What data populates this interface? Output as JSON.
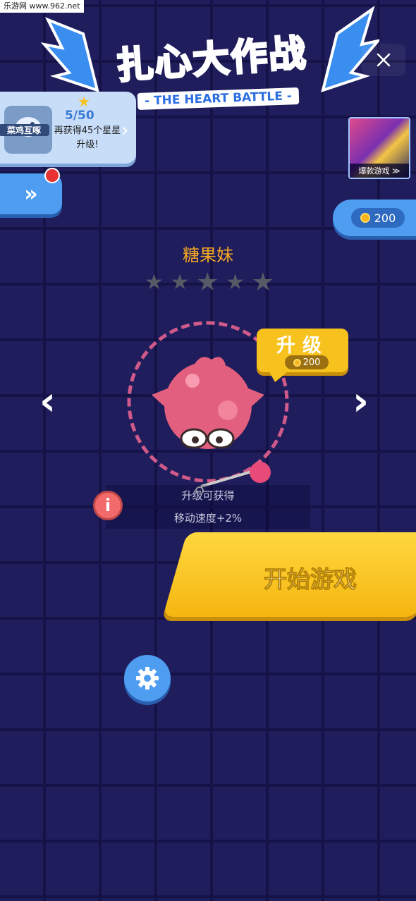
{
  "watermark": "乐游网 www.962.net",
  "logo": {
    "title": "扎心大作战",
    "subtitle": "- THE HEART BATTLE -"
  },
  "close_icon": "close-icon",
  "level": {
    "avatar_label": "菜鸡互啄",
    "star_progress": "5/50",
    "message": "再获得45个星星升级!"
  },
  "promo": {
    "label": "爆款游戏 ≫"
  },
  "coins": {
    "amount": "200"
  },
  "character": {
    "name": "糖果妹",
    "stars_filled": 0,
    "stars_total": 5
  },
  "upgrade": {
    "label": "升级",
    "cost": "200"
  },
  "reward": {
    "title": "升级可获得",
    "value": "移动速度+2%"
  },
  "start": {
    "label": "开始游戏"
  },
  "colors": {
    "accent_yellow": "#f7c21d",
    "accent_blue": "#4e9df0",
    "name_orange": "#f5a623",
    "background": "#1f1d5c"
  }
}
